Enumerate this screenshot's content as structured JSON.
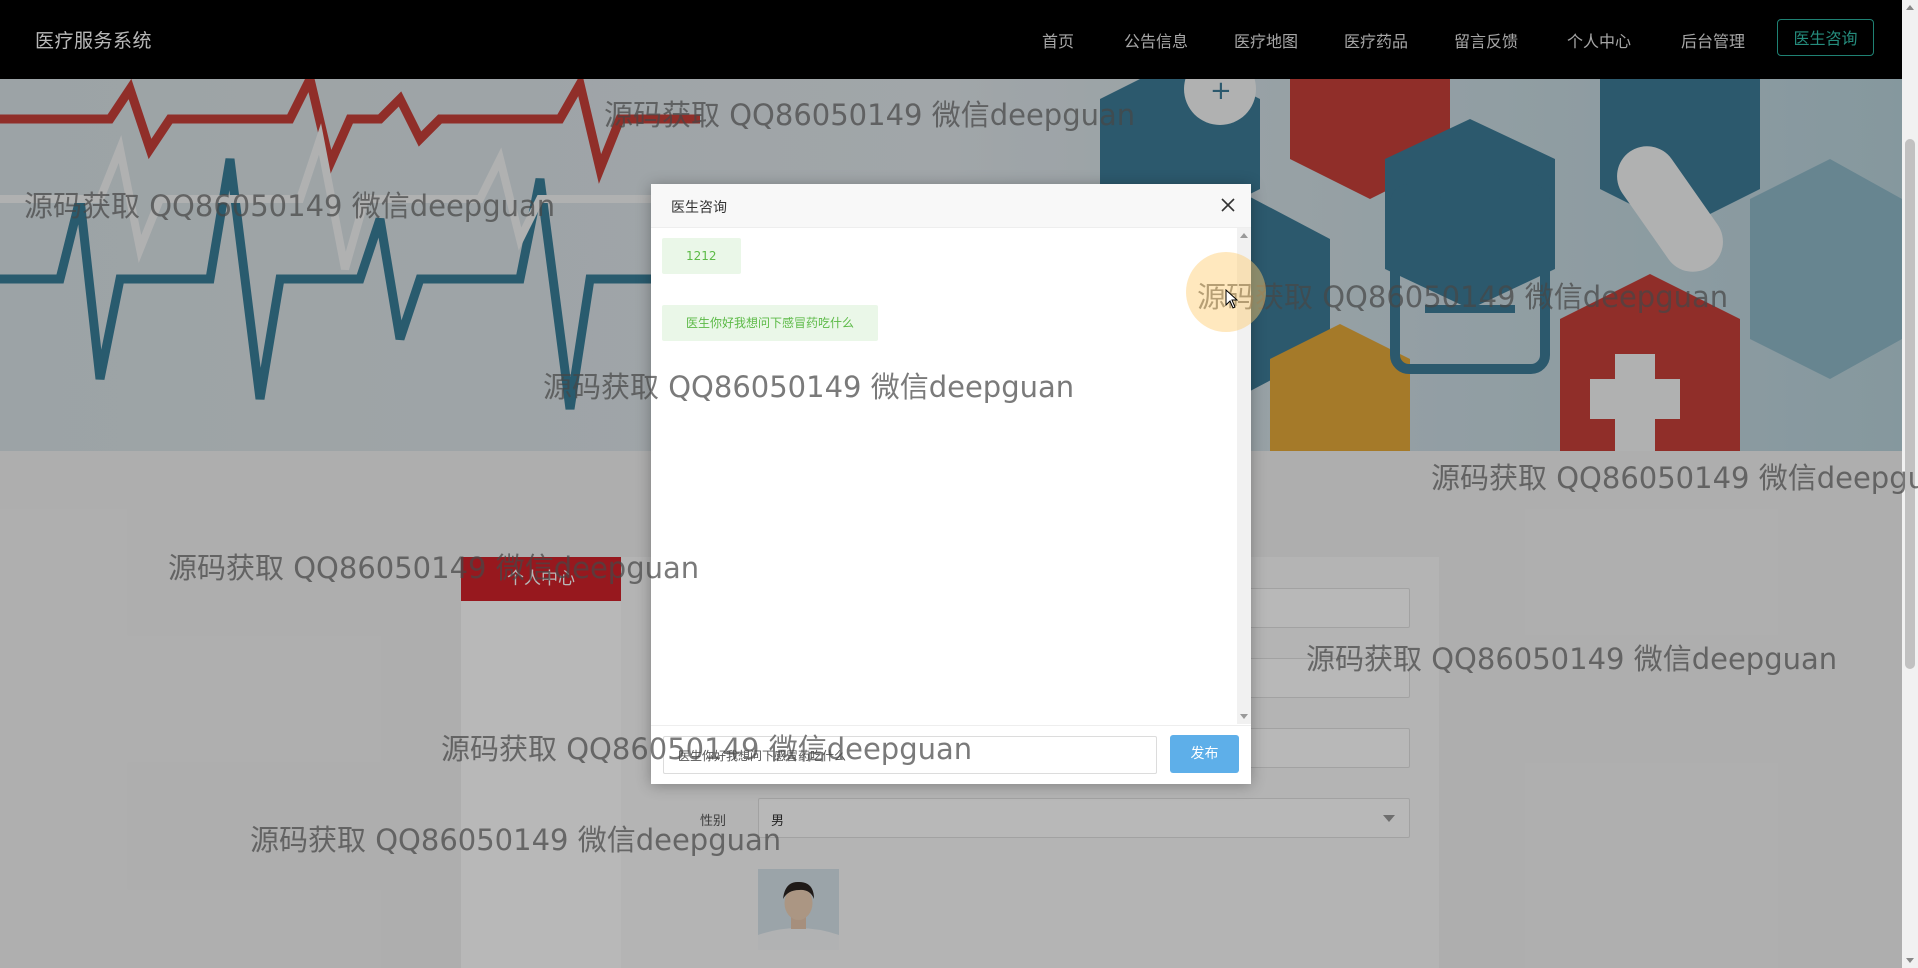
{
  "header": {
    "brand": "医疗服务系统",
    "nav": [
      {
        "label": "首页"
      },
      {
        "label": "公告信息"
      },
      {
        "label": "医疗地图"
      },
      {
        "label": "医疗药品"
      },
      {
        "label": "留言反馈"
      },
      {
        "label": "个人中心"
      },
      {
        "label": "后台管理"
      }
    ],
    "consult_button": "医生咨询"
  },
  "side": {
    "title": "个人中心"
  },
  "form": {
    "gender_label": "性别",
    "gender_value": "男"
  },
  "modal": {
    "title": "医生咨询",
    "messages": [
      {
        "text": "1212"
      },
      {
        "text": "医生你好我想问下感冒药吃什么"
      }
    ],
    "input_value": "医生你好我想问下感冒药吃什么",
    "send_label": "发布"
  },
  "watermark": "源码获取 QQ86050149 微信deepguan",
  "colors": {
    "nav_bg": "#000000",
    "accent_teal": "#2bb3a0",
    "side_title_red": "#d2222a",
    "message_bg": "#eaf7e8",
    "message_text": "#5cba47",
    "send_button": "#5eafe9"
  }
}
